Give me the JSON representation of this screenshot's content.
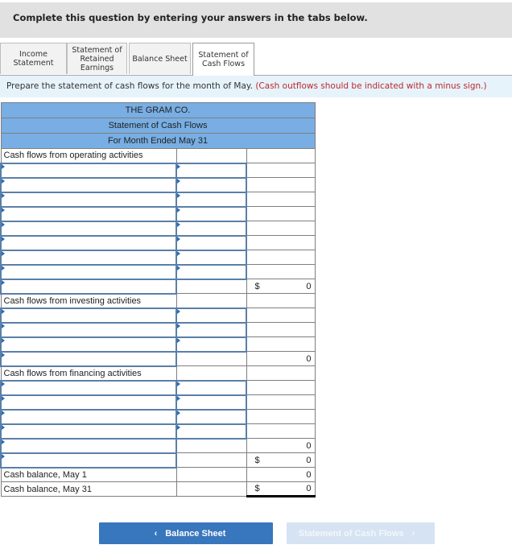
{
  "banner": {
    "text": "Complete this question by entering your answers in the tabs below."
  },
  "tabs": [
    {
      "label": "Income Statement",
      "lines": [
        "Income",
        "Statement"
      ],
      "active": false
    },
    {
      "label": "Statement of Retained Earnings",
      "lines": [
        "Statement of",
        "Retained",
        "Earnings"
      ],
      "active": false
    },
    {
      "label": "Balance Sheet",
      "lines": [
        "Balance Sheet"
      ],
      "active": false
    },
    {
      "label": "Statement of Cash Flows",
      "lines": [
        "Statement of",
        "Cash Flows"
      ],
      "active": true
    }
  ],
  "instruction": {
    "text": "Prepare the statement of cash flows for the month of May.",
    "note": "(Cash outflows should be indicated with a minus sign.)"
  },
  "statement": {
    "company": "THE GRAM CO.",
    "title": "Statement of Cash Flows",
    "period": "For Month Ended May 31",
    "operating_label": "Cash flows from operating activities",
    "operating_subtotal": {
      "currency": "$",
      "value": "0"
    },
    "investing_label": "Cash flows from investing activities",
    "investing_subtotal": {
      "currency": "",
      "value": "0"
    },
    "financing_label": "Cash flows from financing activities",
    "financing_subtotal": {
      "currency": "",
      "value": "0"
    },
    "net_change": {
      "currency": "$",
      "value": "0"
    },
    "beginning": {
      "label": "Cash balance, May 1",
      "value": "0"
    },
    "ending": {
      "label": "Cash balance, May 31",
      "currency": "$",
      "value": "0"
    }
  },
  "nav": {
    "prev_label": "Balance Sheet",
    "next_label": "Statement of Cash Flows",
    "prev_chevron": "‹",
    "next_chevron": "›"
  }
}
